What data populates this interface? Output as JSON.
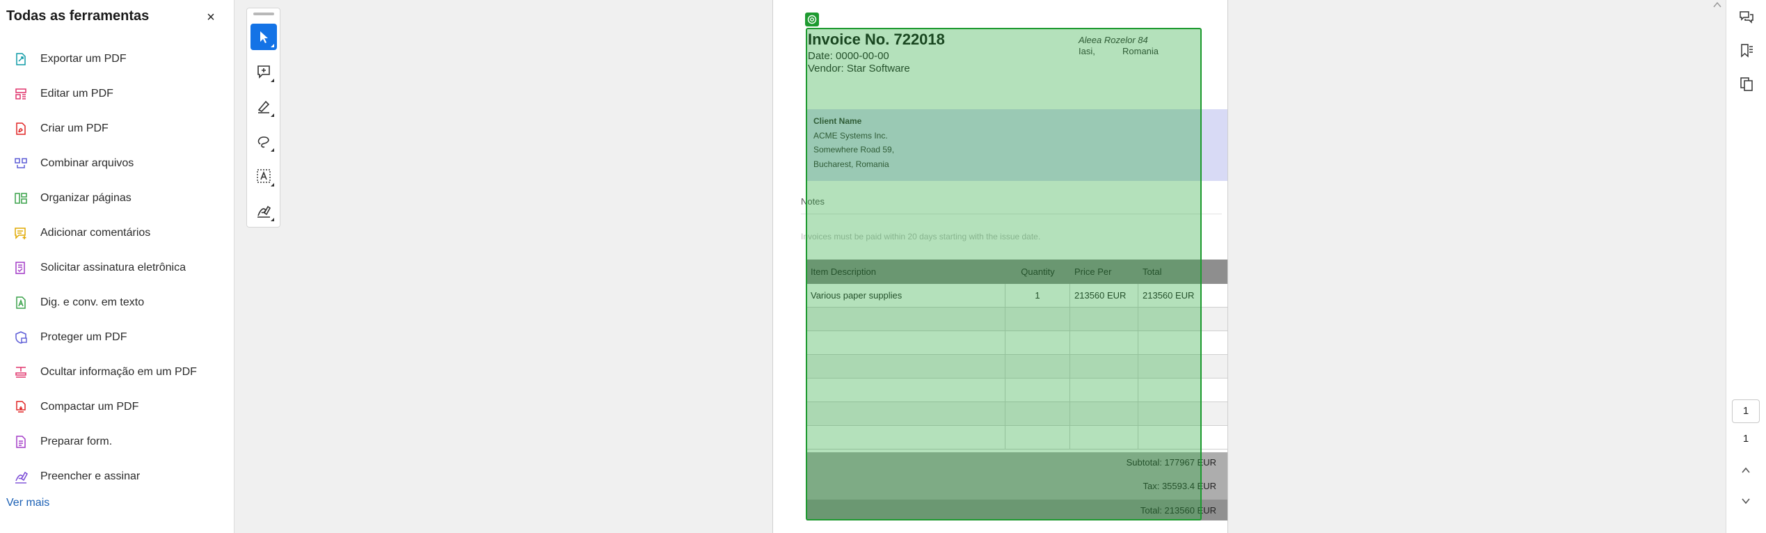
{
  "panel": {
    "title": "Todas as ferramentas",
    "close_label": "×",
    "see_more": "Ver mais",
    "items": [
      {
        "label": "Exportar um PDF",
        "icon": "export-pdf-icon",
        "color": "#0d9aa6"
      },
      {
        "label": "Editar um PDF",
        "icon": "edit-pdf-icon",
        "color": "#e0336b"
      },
      {
        "label": "Criar um PDF",
        "icon": "create-pdf-icon",
        "color": "#e02424"
      },
      {
        "label": "Combinar arquivos",
        "icon": "combine-files-icon",
        "color": "#5b5bd6"
      },
      {
        "label": "Organizar páginas",
        "icon": "organize-pages-icon",
        "color": "#3aa24a"
      },
      {
        "label": "Adicionar comentários",
        "icon": "add-comment-icon",
        "color": "#e0a800"
      },
      {
        "label": "Solicitar assinatura eletrônica",
        "icon": "request-signature-icon",
        "color": "#a33bc7"
      },
      {
        "label": "Dig. e conv. em texto",
        "icon": "scan-ocr-icon",
        "color": "#3aa24a"
      },
      {
        "label": "Proteger um PDF",
        "icon": "protect-pdf-icon",
        "color": "#5b5bd6"
      },
      {
        "label": "Ocultar informação em um PDF",
        "icon": "redact-icon",
        "color": "#e0336b"
      },
      {
        "label": "Compactar um PDF",
        "icon": "compress-pdf-icon",
        "color": "#e02424"
      },
      {
        "label": "Preparar form.",
        "icon": "prepare-form-icon",
        "color": "#a33bc7"
      },
      {
        "label": "Preencher e assinar",
        "icon": "fill-sign-icon",
        "color": "#7b4bd6"
      }
    ]
  },
  "tool_strip": {
    "tools": [
      "select-tool-icon",
      "add-comment-tool-icon",
      "highlight-tool-icon",
      "draw-tool-icon",
      "text-select-tool-icon",
      "sign-tool-icon"
    ],
    "active_color": "#1473e6"
  },
  "invoice": {
    "title": "Invoice No. 722018",
    "date": "Date: 0000-00-00",
    "vendor": "Vendor: Star Software",
    "address_line1": "Aleea Rozelor 84",
    "address_city": "Iasi,",
    "address_country": "Romania",
    "client_label": "Client Name",
    "client_name": "ACME Systems Inc.",
    "client_street": "Somewhere Road 59,",
    "client_city": "Bucharest, Romania",
    "notes_label": "Notes",
    "notes_text": "Invoices must be paid within 20 days starting with the issue date.",
    "table": {
      "headers": [
        "Item Description",
        "Quantity",
        "Price Per",
        "Total"
      ],
      "rows": [
        [
          "Various paper supplies",
          "1",
          "213560 EUR",
          "213560 EUR"
        ]
      ],
      "empty_rows": 6
    },
    "subtotal": "Subtotal: 177967 EUR",
    "tax": "Tax: 35593.4 EUR",
    "total": "Total: 213560 EUR"
  },
  "selection": {
    "color": "#1e9a30"
  },
  "right_bar": {
    "icons": [
      "comments-icon",
      "bookmarks-icon",
      "pages-icon"
    ],
    "current_page": "1",
    "total_pages": "1",
    "nav": [
      "page-up-icon",
      "page-down-icon"
    ]
  }
}
